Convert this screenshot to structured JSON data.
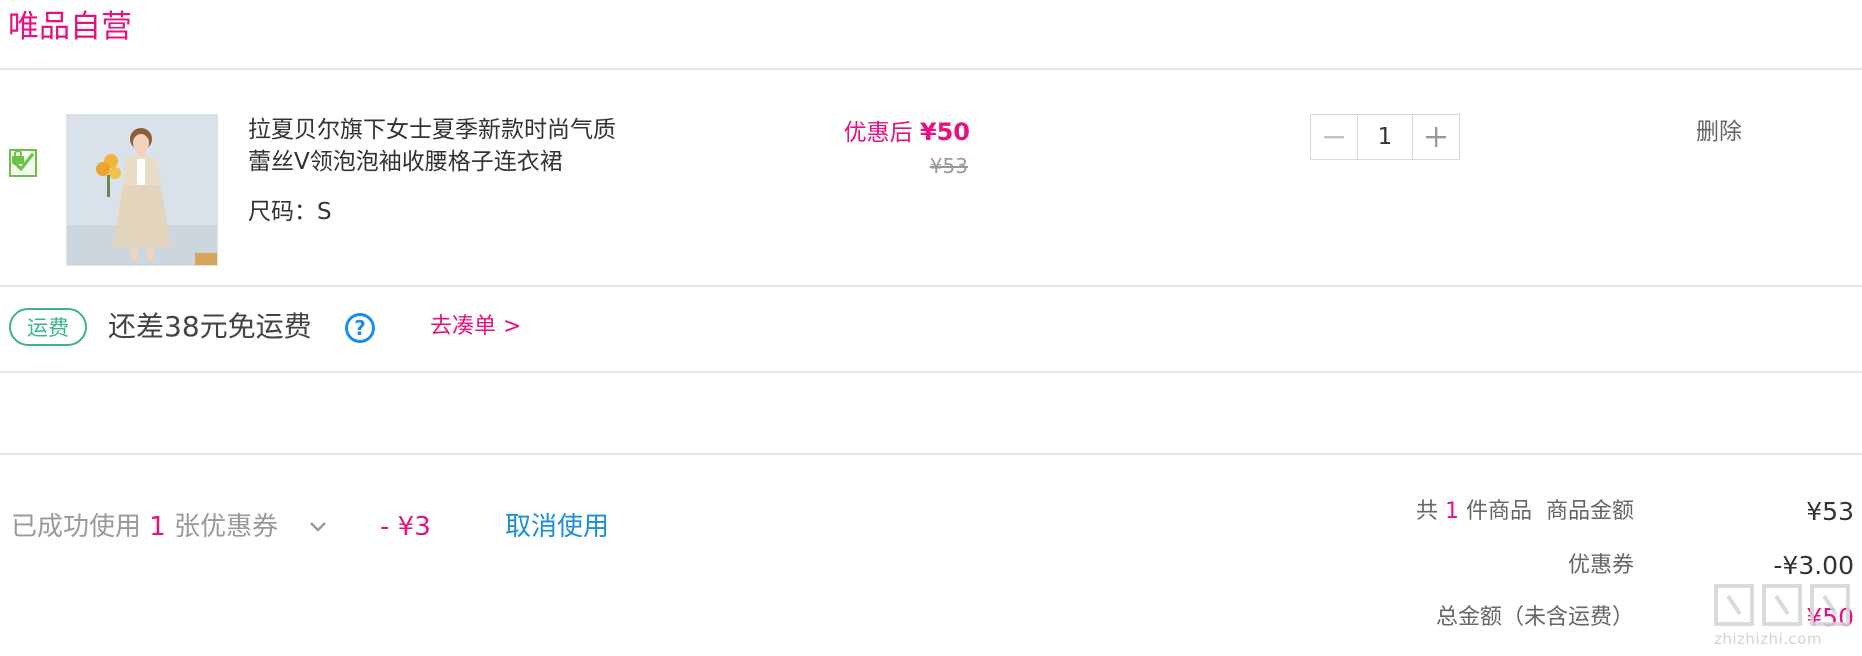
{
  "store": {
    "title": "唯品自营"
  },
  "product": {
    "name": "拉夏贝尔旗下女士夏季新款时尚气质蕾丝V领泡泡袖收腰格子连衣裙",
    "spec_label": "尺码：",
    "spec_value": "S",
    "price_after_label": "优惠后",
    "price_after": "¥50",
    "price_original": "¥53",
    "quantity": "1",
    "delete_label": "删除",
    "checked": true
  },
  "shipping": {
    "badge": "运费",
    "message": "还差38元免运费",
    "help_icon": "?",
    "addon_link": "去凑单 >"
  },
  "coupon": {
    "prefix": "已成功使用",
    "count": "1",
    "suffix": "张优惠券",
    "discount": "- ¥3",
    "cancel_label": "取消使用"
  },
  "summary": {
    "items_prefix": "共",
    "items_count": "1",
    "items_suffix": "件商品  商品金额",
    "goods_amount": "¥53",
    "coupon_label": "优惠券",
    "coupon_amount": "-¥3.00",
    "total_label": "总金额（未含运费）",
    "total_amount": "¥50"
  },
  "watermark": {
    "text": "zhizhizhi.com"
  },
  "colors": {
    "brand": "#e4127f",
    "link_blue": "#1a8fd5",
    "shipping_green": "#3cb48a",
    "check_green": "#6fc04a"
  }
}
